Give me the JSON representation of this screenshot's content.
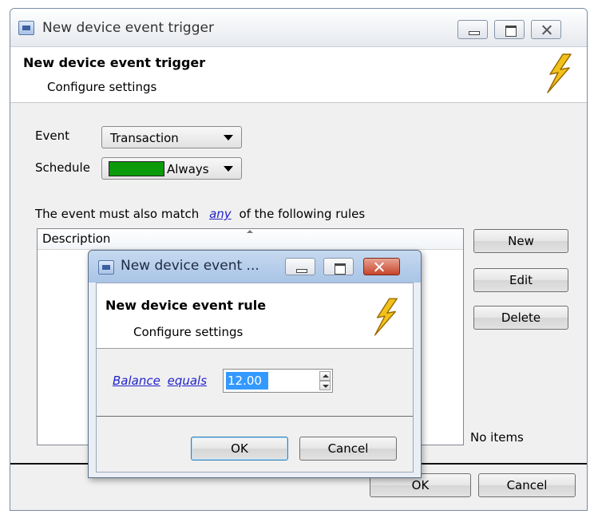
{
  "main_window": {
    "title": "New device event trigger",
    "header": {
      "title": "New device event trigger",
      "subtitle": "Configure settings"
    },
    "event": {
      "label": "Event",
      "value": "Transaction"
    },
    "schedule": {
      "label": "Schedule",
      "value": "Always",
      "swatch_color": "#0a9a0a"
    },
    "rules_text": {
      "before": "The event must also match",
      "link": "any",
      "after": "of the following rules"
    },
    "list": {
      "column_header": "Description",
      "empty_text": "No items"
    },
    "side_buttons": {
      "new": "New",
      "edit": "Edit",
      "delete": "Delete"
    },
    "footer": {
      "ok": "OK",
      "cancel": "Cancel"
    }
  },
  "rule_dialog": {
    "title": "New device event ...",
    "header": {
      "title": "New device event rule",
      "subtitle": "Configure settings"
    },
    "field_link": "Balance",
    "operator_link": "equals",
    "value": "12.00",
    "footer": {
      "ok": "OK",
      "cancel": "Cancel"
    }
  },
  "icons": {
    "window": "window-icon",
    "bolt": "lightning-bolt-icon",
    "minimize": "minimize-icon",
    "maximize": "maximize-icon",
    "close": "close-icon"
  },
  "colors": {
    "link": "#2222cc",
    "bolt": "#f2c21b",
    "selection": "#3399ff"
  }
}
